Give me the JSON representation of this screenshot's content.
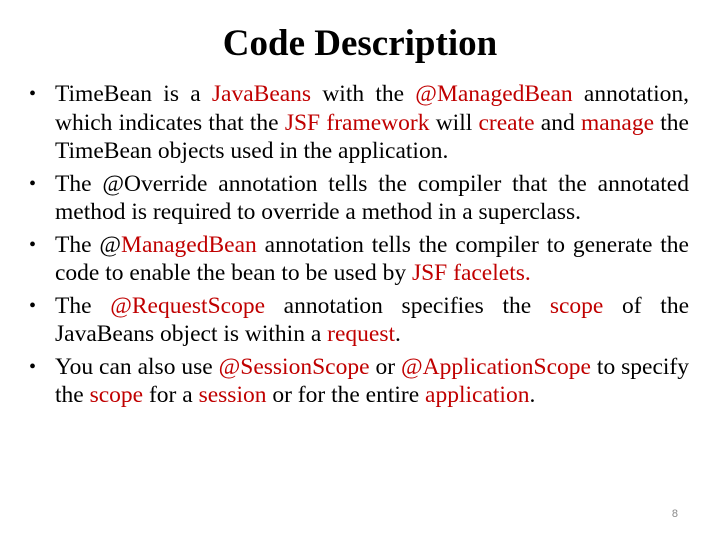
{
  "slide": {
    "title": "Code Description",
    "page_number": "8",
    "highlight_color": "#c00000",
    "bullets": [
      {
        "segments": [
          {
            "text": "TimeBean is a ",
            "hl": false
          },
          {
            "text": "JavaBeans",
            "hl": true
          },
          {
            "text": " with the ",
            "hl": false
          },
          {
            "text": "@ManagedBean",
            "hl": true
          },
          {
            "text": " annotation, which indicates that the ",
            "hl": false
          },
          {
            "text": "JSF framework",
            "hl": true
          },
          {
            "text": " will ",
            "hl": false
          },
          {
            "text": "create",
            "hl": true
          },
          {
            "text": " and ",
            "hl": false
          },
          {
            "text": "manage",
            "hl": true
          },
          {
            "text": " the TimeBean objects used in the application.",
            "hl": false
          }
        ]
      },
      {
        "segments": [
          {
            "text": "The @Override annotation tells the compiler that the annotated method is required to override a method in a superclass.",
            "hl": false
          }
        ]
      },
      {
        "segments": [
          {
            "text": "The @",
            "hl": false
          },
          {
            "text": "ManagedBean",
            "hl": true
          },
          {
            "text": " annotation tells the compiler to generate the code to enable the bean to be used by ",
            "hl": false
          },
          {
            "text": "JSF facelets.",
            "hl": true
          }
        ]
      },
      {
        "segments": [
          {
            "text": "The ",
            "hl": false
          },
          {
            "text": "@RequestScope",
            "hl": true
          },
          {
            "text": " annotation specifies the ",
            "hl": false
          },
          {
            "text": "scope",
            "hl": true
          },
          {
            "text": " of the JavaBeans object is within a ",
            "hl": false
          },
          {
            "text": "request",
            "hl": true
          },
          {
            "text": ".",
            "hl": false
          }
        ]
      },
      {
        "segments": [
          {
            "text": "You can also use ",
            "hl": false
          },
          {
            "text": "@SessionScope",
            "hl": true
          },
          {
            "text": " or ",
            "hl": false
          },
          {
            "text": "@ApplicationScope",
            "hl": true
          },
          {
            "text": " to specify the ",
            "hl": false
          },
          {
            "text": "scope",
            "hl": true
          },
          {
            "text": " for a ",
            "hl": false
          },
          {
            "text": "session",
            "hl": true
          },
          {
            "text": " or for the entire ",
            "hl": false
          },
          {
            "text": "application",
            "hl": true
          },
          {
            "text": ".",
            "hl": false
          }
        ]
      }
    ]
  }
}
